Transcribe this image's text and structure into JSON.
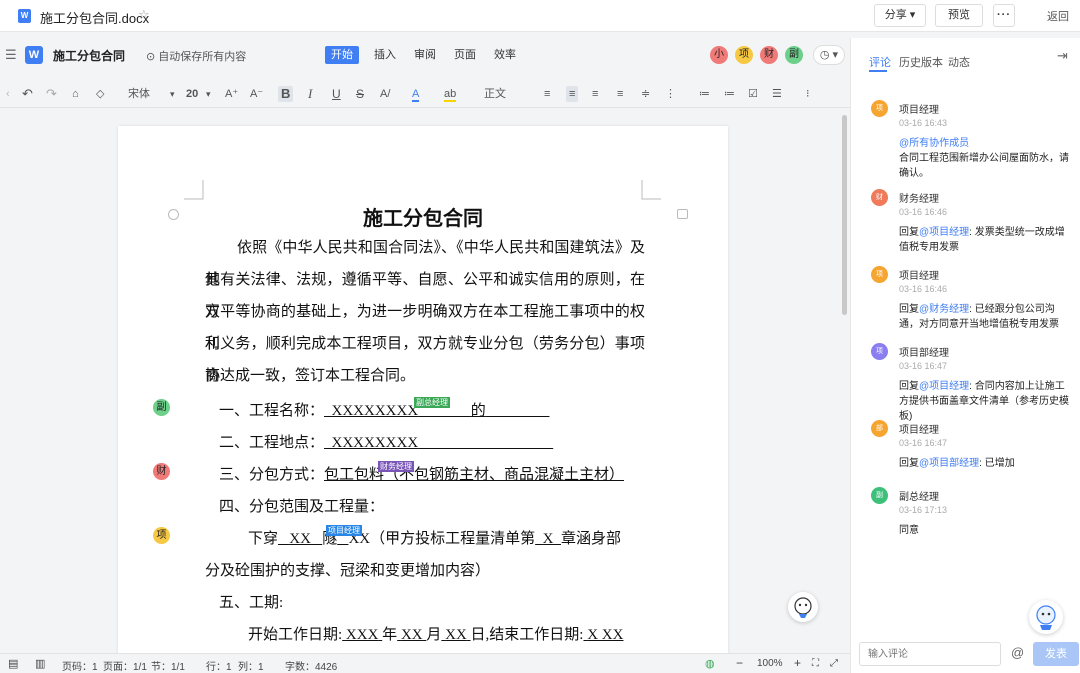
{
  "topbar": {
    "doc_icon": "W",
    "filename": "施工分包合同.docx",
    "star_icon": "☆",
    "share": "分享 ▾",
    "preview": "预览",
    "more": "···",
    "back": "返回"
  },
  "menubar": {
    "hamburger_icon": "☰",
    "app_icon": "W",
    "title": "施工分包合同",
    "autosave": "⊙ 自动保存所有内容",
    "tabs": [
      {
        "label": "开始"
      },
      {
        "label": "插入"
      },
      {
        "label": "审阅"
      },
      {
        "label": "页面"
      },
      {
        "label": "效率"
      }
    ],
    "avatars": [
      {
        "label": "小",
        "color": "#f07a78"
      },
      {
        "label": "项",
        "color": "#f7c843"
      },
      {
        "label": "财",
        "color": "#f07a78"
      },
      {
        "label": "副",
        "color": "#6ccf8a"
      }
    ],
    "clock": "◷ ▾"
  },
  "toolbar": {
    "font": "宋体",
    "font_caret": "▾",
    "size": "20",
    "size_caret": "▾",
    "grow": "A⁺",
    "shrink": "A⁻",
    "bold": "B",
    "italic": "I",
    "underline": "U",
    "strike": "S",
    "super": "A/",
    "fontcolor": "A",
    "highlight": "ab",
    "style": "正文",
    "undo_icon": "↶",
    "redo_icon": "↷",
    "brush_icon": "⌂",
    "eraser_icon": "◇",
    "left_arrow": "‹",
    "align_icons": [
      "≡",
      "≡",
      "≡",
      "≡",
      "≑",
      "⋮",
      "≔",
      "≔",
      "☑",
      "☰",
      "⁝"
    ]
  },
  "document": {
    "title": "施工分包合同",
    "intro_lines": [
      "依照《中华人民共和国合同法》、《中华人民共和国建筑法》及其",
      "他有关法律、法规，遵循平等、自愿、公平和诚实信用的原则，在双",
      "方平等协商的基础上，为进一步明确双方在本工程施工事项中的权利",
      "和义务，顺利完成本工程项目，双方就专业分包（劳务分包）事项协",
      "商达成一致，签订本工程合同。"
    ],
    "item1_label": "一、工程名称：",
    "item1_value": "XXXXXXXX",
    "item1_suffix": "的",
    "item1_tag": "副总经理",
    "item2_label": "二、工程地点：",
    "item2_value": "XXXXXXXX",
    "item3_label": "三、分包方式：",
    "item3_value": "包工包料（不包钢筋主材、商品混凝土主材）",
    "item3_tag": "财务经理",
    "item4_label": "四、分包范围及工程量：",
    "item4a": "下穿",
    "item4b": "XX",
    "item4c": "隧",
    "item4d": "XX（甲方投标工程量清单第",
    "item4e": "X",
    "item4f": "章涵身部",
    "item4_tag": "项目经理",
    "item4_line2": "分及砼围护的支撑、冠梁和变更增加内容）",
    "item5_label": "五、工期:",
    "item5_line": "开始工作日期:",
    "item5_y": "XXX",
    "item5_yl": "年",
    "item5_m": "XX",
    "item5_ml": "月",
    "item5_d": "XX",
    "item5_dl": "日,结束工作日期:",
    "item5_end": "X XX",
    "side_avatars": [
      {
        "label": "副",
        "color": "#6ccf8a"
      },
      {
        "label": "财",
        "color": "#f07a78"
      },
      {
        "label": "项",
        "color": "#f7c843"
      }
    ]
  },
  "statusbar": {
    "icons": [
      "▤",
      "▥"
    ],
    "page": "页码：1",
    "pages": "页面：1/1",
    "section": "节：1/1",
    "row": "行：1",
    "col": "列：1",
    "words": "字数：4426",
    "zoom_out": "−",
    "zoom": "100%",
    "zoom_in": "+",
    "fit_icon": "⛶",
    "expand_icon": "⤢",
    "cloud_icon": "◍"
  },
  "panel": {
    "tabs": [
      "评论",
      "历史版本",
      "动态"
    ],
    "collapse_icon": "⇥",
    "comments": [
      {
        "avatar": "项",
        "color": "#f7a531",
        "name": "项目经理",
        "time": "03-16 16:43",
        "mention": "@所有协作成员",
        "text": "合同工程范围新增办公间屋面防水，请确认。",
        "reply_prefix": ""
      },
      {
        "avatar": "财",
        "color": "#f07a5a",
        "name": "财务经理",
        "time": "03-16 16:46",
        "mention": "@项目经理",
        "text": ": 发票类型统一改成增值税专用发票",
        "reply_prefix": "回复"
      },
      {
        "avatar": "项",
        "color": "#f7a531",
        "name": "项目经理",
        "time": "03-16 16:46",
        "mention": "@财务经理",
        "text": ": 已经跟分包公司沟通，对方同意开当地增值税专用发票",
        "reply_prefix": "回复"
      },
      {
        "avatar": "项",
        "color": "#8a7ef0",
        "name": "项目部经理",
        "time": "03-16 16:47",
        "mention": "@项目经理",
        "text": ": 合同内容加上让施工方提供书面盖章文件清单（参考历史模板)",
        "reply_prefix": "回复"
      },
      {
        "avatar": "部",
        "color": "#f7a531",
        "name": "项目经理",
        "time": "03-16 16:47",
        "mention": "@项目部经理",
        "text": ": 已增加",
        "reply_prefix": "回复"
      },
      {
        "avatar": "副",
        "color": "#3cc07a",
        "name": "副总经理",
        "time": "03-16 17:13",
        "mention": "",
        "text": "同意",
        "reply_prefix": ""
      }
    ],
    "input_placeholder": "输入评论",
    "at": "@",
    "send": "发表"
  }
}
